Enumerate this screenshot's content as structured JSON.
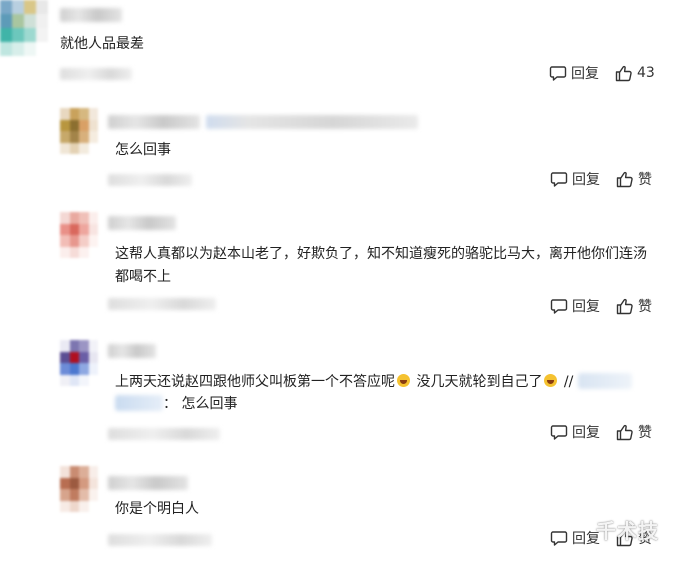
{
  "icons": {
    "reply": "comment-bubble-icon",
    "like": "thumbs-up-icon"
  },
  "comments": [
    {
      "text": "就他人品最差",
      "reply_label": "回复",
      "like_label": "43"
    },
    {
      "text": "怎么回事",
      "reply_label": "回复",
      "like_label": "赞"
    },
    {
      "text": "这帮人真都以为赵本山老了，好欺负了，知不知道瘦死的骆驼比马大，离开他你们连汤都喝不上",
      "reply_label": "回复",
      "like_label": "赞"
    },
    {
      "text_part1": "上两天还说赵四跟他师父叫板第一个不答应呢",
      "text_part2": "没几天就轮到自己了",
      "text_sep": "//",
      "quote_text": "：  怎么回事",
      "reply_label": "回复",
      "like_label": "赞"
    },
    {
      "text": "你是个明白人",
      "reply_label": "回复",
      "like_label": "赞"
    }
  ],
  "watermark": "千术技"
}
